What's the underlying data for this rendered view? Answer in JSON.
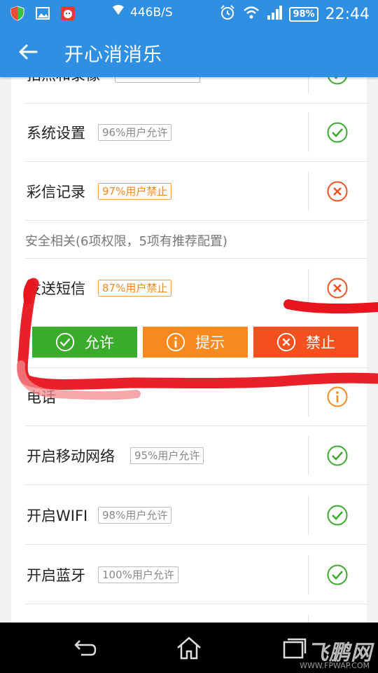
{
  "status_bar": {
    "network_speed": "446B/S",
    "battery": "98%",
    "time": "22:44",
    "icons": [
      "shield-icon",
      "image-icon",
      "cat-app-icon",
      "wifi-download-icon",
      "alarm-icon",
      "wifi-icon",
      "signal-icon",
      "battery-icon"
    ]
  },
  "app_bar": {
    "title": "开心消消乐",
    "back_icon": "arrow-left-icon"
  },
  "rows": [
    {
      "name": "拍照和录像",
      "badge": "",
      "status": "allow"
    },
    {
      "name": "系统设置",
      "badge": "96%用户允许",
      "badge_type": "allow",
      "status": "allow"
    },
    {
      "name": "彩信记录",
      "badge": "97%用户禁止",
      "badge_type": "deny",
      "status": "deny"
    }
  ],
  "section_title": "安全相关(6项权限，5项有推荐配置)",
  "security_rows": [
    {
      "name": "发送短信",
      "badge": "87%用户禁止",
      "badge_type": "deny",
      "status": "deny"
    },
    {
      "name": "电话",
      "badge": "",
      "status": "hint"
    },
    {
      "name": "开启移动网络",
      "badge": "95%用户允许",
      "badge_type": "allow",
      "status": "allow"
    },
    {
      "name": "开启WIFI",
      "badge": "98%用户允许",
      "badge_type": "allow",
      "status": "allow"
    },
    {
      "name": "开启蓝牙",
      "badge": "100%用户允许",
      "badge_type": "allow",
      "status": "allow"
    }
  ],
  "actions": {
    "allow": "允许",
    "hint": "提示",
    "deny": "禁止"
  },
  "colors": {
    "primary": "#2f8fe3",
    "allow": "#3aab2b",
    "hint": "#f7891f",
    "deny": "#f4511e",
    "scribble": "#e8141e"
  },
  "nav": {
    "icons": [
      "back-nav-icon",
      "home-nav-icon",
      "recent-apps-icon"
    ],
    "watermark": "飞鹏网",
    "watermark_url": "WWW.FPWAP.COM"
  }
}
